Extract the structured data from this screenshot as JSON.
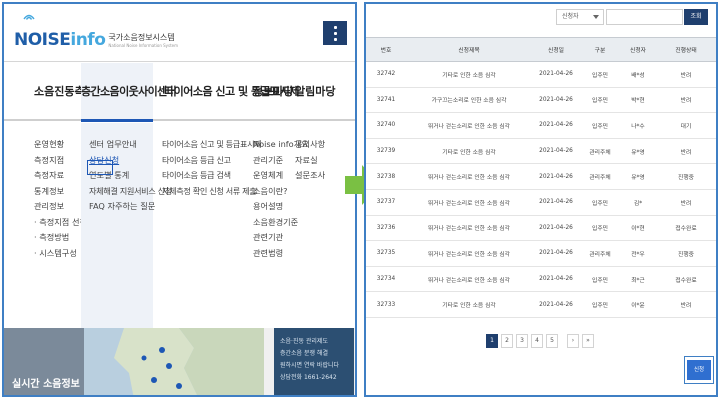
{
  "left": {
    "logo": {
      "mark_main": "NOISE",
      "mark_accent": "info",
      "title_ko": "국가소음정보시스템",
      "title_en": "National Noise Information System"
    },
    "gnb": [
      {
        "label": "소음진동측정망"
      },
      {
        "label": "층간소음이웃사이센터"
      },
      {
        "label": "타이어소음 신고 및 등급표시제"
      },
      {
        "label": "정보마당"
      },
      {
        "label": "알림마당"
      }
    ],
    "submenus": [
      [
        "운영현황",
        "측정지점",
        "측정자료",
        "통계정보",
        "관리정보",
        "· 측정지점 선정기준",
        "· 측정방법",
        "· 시스템구성"
      ],
      [
        "센터 업무안내",
        "상담신청",
        "연도별 통계",
        "자체해결 지원서비스 신청",
        "FAQ 자주하는 질문"
      ],
      [
        "타이어소음 신고 및 등급표시제",
        "타이어소음 등급 신고",
        "타이어소음 등급 검색",
        "자체측정 확인 신청 서류 제출"
      ],
      [
        "Noise info개요",
        "관리기준",
        "운영체계",
        "소음이란?",
        "용어설명",
        "소음환경기준",
        "관련기관",
        "관련법령"
      ],
      [
        "공지사항",
        "자료실",
        "설문조사"
      ]
    ],
    "realtime_label": "실시간 소음정보",
    "promo_lines": [
      "소음·진동 관리제도",
      "층간소음 분쟁 해결",
      "원하시면 연락 바랍니다",
      "상담전화 1661-2642"
    ]
  },
  "right": {
    "search": {
      "select_value": "신청자",
      "input_value": "",
      "button_label": "조회"
    },
    "table": {
      "headers": [
        "번호",
        "신청제목",
        "신청일",
        "구분",
        "신청자",
        "진행상태"
      ],
      "rows": [
        [
          "32742",
          "기타로 인한 소음 심각",
          "2021-04-26",
          "입주민",
          "배*성",
          "반려"
        ],
        [
          "32741",
          "가구끄는소리로 인한 소음 심각",
          "2021-04-26",
          "입주민",
          "박*현",
          "반려"
        ],
        [
          "32740",
          "뛰거나 걷는소리로 인한 소음 심각",
          "2021-04-26",
          "입주민",
          "나*수",
          "대기"
        ],
        [
          "32739",
          "기타로 인한 소음 심각",
          "2021-04-26",
          "관리주체",
          "유*영",
          "반려"
        ],
        [
          "32738",
          "뛰거나 걷는소리로 인한 소음 심각",
          "2021-04-26",
          "관리주체",
          "유*영",
          "진행중"
        ],
        [
          "32737",
          "뛰거나 걷는소리로 인한 소음 심각",
          "2021-04-26",
          "입주민",
          "김*",
          "반려"
        ],
        [
          "32736",
          "뛰거나 걷는소리로 인한 소음 심각",
          "2021-04-26",
          "입주민",
          "이*현",
          "접수완료"
        ],
        [
          "32735",
          "뛰거나 걷는소리로 인한 소음 심각",
          "2021-04-26",
          "관리주체",
          "전*우",
          "진행중"
        ],
        [
          "32734",
          "뛰거나 걷는소리로 인한 소음 심각",
          "2021-04-26",
          "입주민",
          "최*근",
          "접수완료"
        ],
        [
          "32733",
          "기타로 인한 소음 심각",
          "2021-04-26",
          "입주민",
          "이*윤",
          "반려"
        ]
      ]
    },
    "pagination": {
      "pages": [
        "1",
        "2",
        "3",
        "4",
        "5"
      ],
      "active": "1",
      "next": "›",
      "last": "»"
    },
    "apply_button": "신청"
  },
  "colors": {
    "accent": "#1d57b5",
    "dark_navy": "#1f3f6e",
    "border_blue": "#3f7fc4",
    "arrow_green": "#7ac043"
  }
}
